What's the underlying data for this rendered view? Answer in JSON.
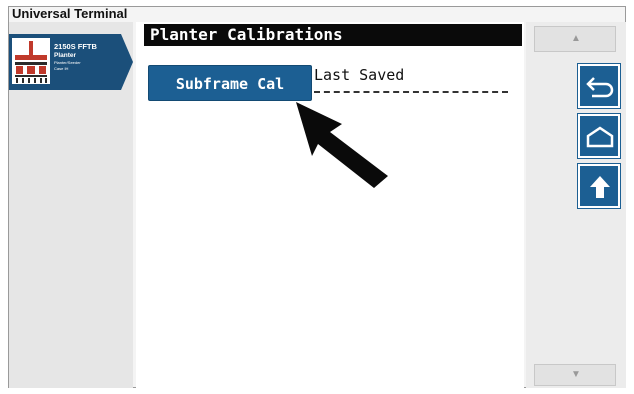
{
  "app": {
    "title": "Universal Terminal"
  },
  "implement": {
    "name": "2150S FFTB",
    "type": "Planter",
    "subtitle": "Planter/Seeder",
    "detail": "Case IH"
  },
  "screen": {
    "title": "Planter Calibrations",
    "subframe_button": "Subframe Cal",
    "last_saved_label": "Last Saved",
    "last_saved_value": "----------------"
  },
  "nav": {
    "scroll_up_icon": "scroll-up-icon",
    "scroll_down_icon": "scroll-down-icon",
    "back_icon": "back-arrow-icon",
    "home_icon": "home-icon",
    "up_icon": "up-arrow-icon"
  },
  "colors": {
    "accent": "#1c5f93",
    "title_bar": "#0a0a0a",
    "implement_card": "#1b4f7a"
  }
}
